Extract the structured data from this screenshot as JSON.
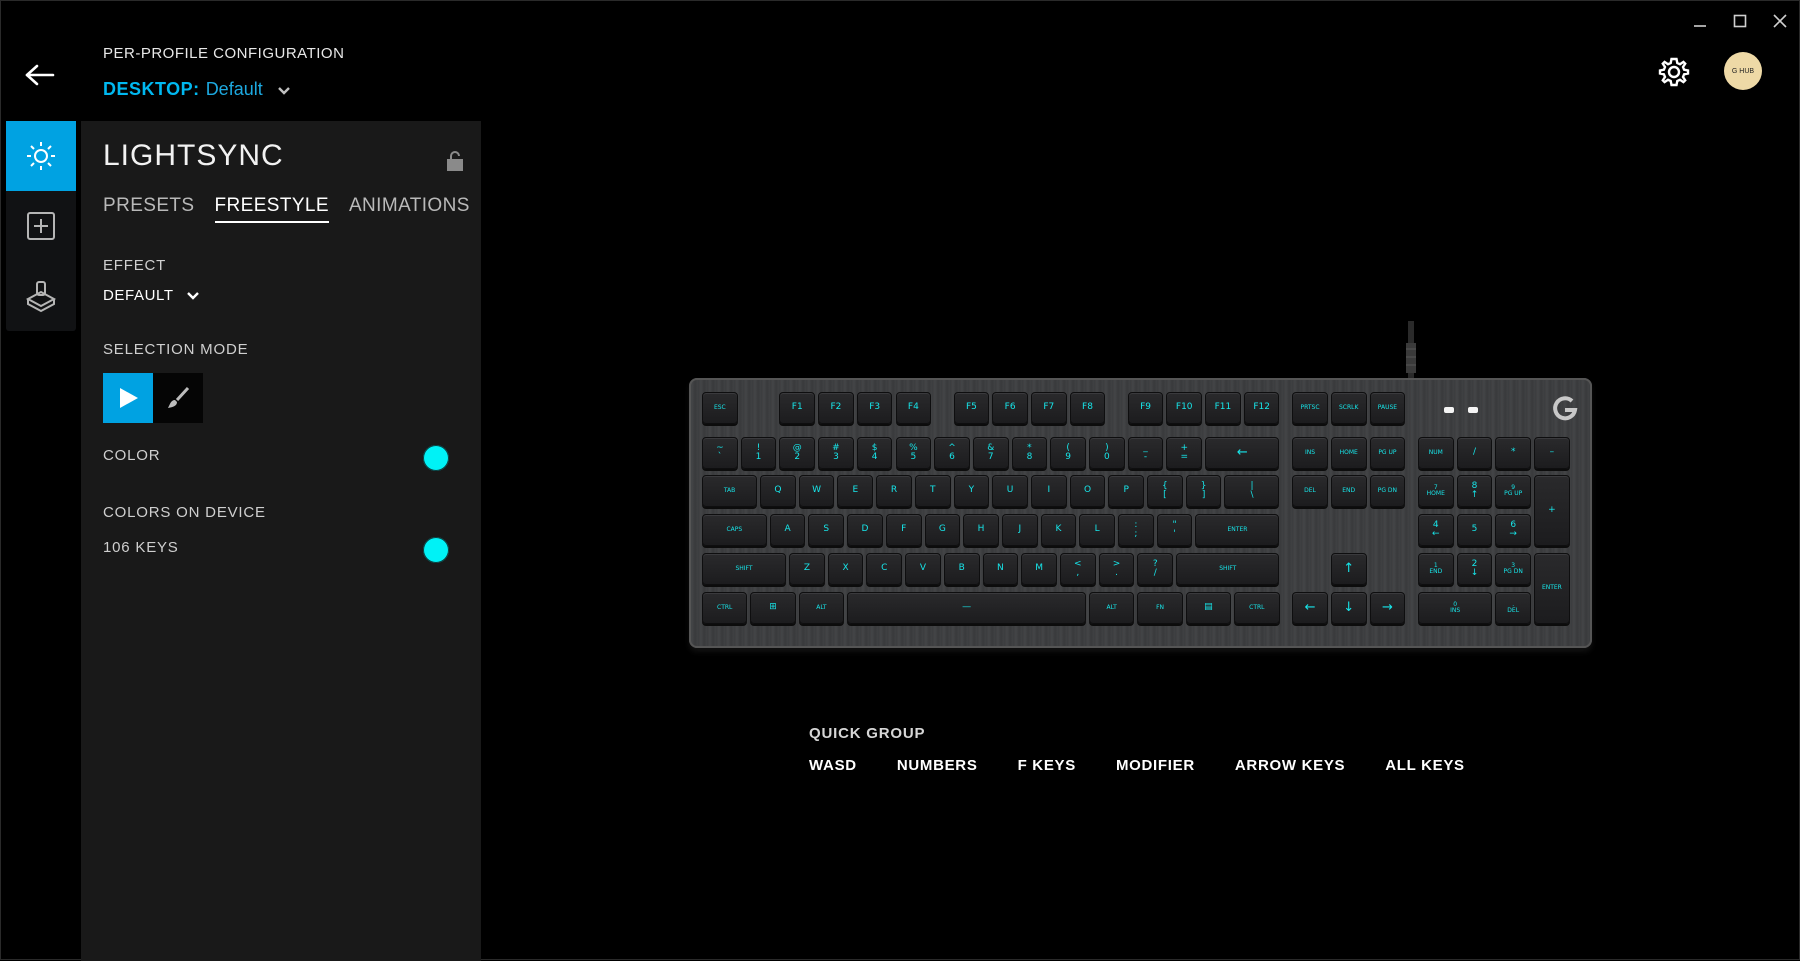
{
  "window": {
    "minimize_icon": "minimize-icon",
    "maximize_icon": "maximize-icon",
    "close_icon": "close-icon"
  },
  "header": {
    "config_title": "PER-PROFILE CONFIGURATION",
    "profile_key": "DESKTOP:",
    "profile_value": "Default",
    "avatar_text": "G HUB"
  },
  "rail": [
    "lightsync-icon",
    "assignments-icon",
    "game-mode-icon"
  ],
  "panel": {
    "title": "LIGHTSYNC",
    "tabs": [
      {
        "label": "PRESETS",
        "active": false
      },
      {
        "label": "FREESTYLE",
        "active": true
      },
      {
        "label": "ANIMATIONS",
        "active": false
      }
    ],
    "effect_label": "EFFECT",
    "effect_value": "DEFAULT",
    "selection_mode_label": "SELECTION MODE",
    "color_label": "COLOR",
    "color_value": "#00f2f6",
    "colors_on_device_label": "COLORS ON DEVICE",
    "keys_count_label": "106 KEYS",
    "keys_color": "#00f2f6"
  },
  "keyboard": {
    "accent": "#17e6ea",
    "keys": [
      {
        "id": "esc",
        "l": "ESC"
      },
      {
        "id": "f1",
        "l": "F1"
      },
      {
        "id": "f2",
        "l": "F2"
      },
      {
        "id": "f3",
        "l": "F3"
      },
      {
        "id": "f4",
        "l": "F4"
      },
      {
        "id": "f5",
        "l": "F5"
      },
      {
        "id": "f6",
        "l": "F6"
      },
      {
        "id": "f7",
        "l": "F7"
      },
      {
        "id": "f8",
        "l": "F8"
      },
      {
        "id": "f9",
        "l": "F9"
      },
      {
        "id": "f10",
        "l": "F10"
      },
      {
        "id": "f11",
        "l": "F11"
      },
      {
        "id": "f12",
        "l": "F12"
      },
      {
        "id": "prtsc",
        "l": "PRTSC"
      },
      {
        "id": "scrlk",
        "l": "SCRLK"
      },
      {
        "id": "pause",
        "l": "PAUSE"
      },
      {
        "id": "tilde",
        "l": "~\n`"
      },
      {
        "id": "n1",
        "l": "!\n1"
      },
      {
        "id": "n2",
        "l": "@\n2"
      },
      {
        "id": "n3",
        "l": "#\n3"
      },
      {
        "id": "n4",
        "l": "$\n4"
      },
      {
        "id": "n5",
        "l": "%\n5"
      },
      {
        "id": "n6",
        "l": "^\n6"
      },
      {
        "id": "n7",
        "l": "&\n7"
      },
      {
        "id": "n8",
        "l": "*\n8"
      },
      {
        "id": "n9",
        "l": "(\n9"
      },
      {
        "id": "n0",
        "l": ")\n0"
      },
      {
        "id": "minus",
        "l": "_\n-"
      },
      {
        "id": "equal",
        "l": "+\n="
      },
      {
        "id": "bksp",
        "l": "←"
      },
      {
        "id": "ins",
        "l": "INS"
      },
      {
        "id": "home",
        "l": "HOME"
      },
      {
        "id": "pgup",
        "l": "PG UP"
      },
      {
        "id": "num",
        "l": "NUM"
      },
      {
        "id": "ndiv",
        "l": "/"
      },
      {
        "id": "nmul",
        "l": "*"
      },
      {
        "id": "nsub",
        "l": "–"
      },
      {
        "id": "tab",
        "l": "TAB"
      },
      {
        "id": "q",
        "l": "Q"
      },
      {
        "id": "w",
        "l": "W"
      },
      {
        "id": "e",
        "l": "E"
      },
      {
        "id": "r",
        "l": "R"
      },
      {
        "id": "t",
        "l": "T"
      },
      {
        "id": "y",
        "l": "Y"
      },
      {
        "id": "u",
        "l": "U"
      },
      {
        "id": "i",
        "l": "I"
      },
      {
        "id": "o",
        "l": "O"
      },
      {
        "id": "p",
        "l": "P"
      },
      {
        "id": "lbr",
        "l": "{\n["
      },
      {
        "id": "rbr",
        "l": "}\n]"
      },
      {
        "id": "bslash",
        "l": "|\n\\"
      },
      {
        "id": "del",
        "l": "DEL"
      },
      {
        "id": "end",
        "l": "END"
      },
      {
        "id": "pgdn",
        "l": "PG DN"
      },
      {
        "id": "n7k",
        "l": "7\nHOME"
      },
      {
        "id": "n8k",
        "l": "8\n↑"
      },
      {
        "id": "n9k",
        "l": "9\nPG UP"
      },
      {
        "id": "nadd",
        "l": "+"
      },
      {
        "id": "caps",
        "l": "CAPS"
      },
      {
        "id": "a",
        "l": "A"
      },
      {
        "id": "s",
        "l": "S"
      },
      {
        "id": "d",
        "l": "D"
      },
      {
        "id": "f",
        "l": "F"
      },
      {
        "id": "g",
        "l": "G"
      },
      {
        "id": "h",
        "l": "H"
      },
      {
        "id": "j",
        "l": "J"
      },
      {
        "id": "k",
        "l": "K"
      },
      {
        "id": "lk",
        "l": "L"
      },
      {
        "id": "semi",
        "l": ":\n;"
      },
      {
        "id": "quote",
        "l": "\"\n'"
      },
      {
        "id": "enter",
        "l": "ENTER"
      },
      {
        "id": "n4k",
        "l": "4\n←"
      },
      {
        "id": "n5k",
        "l": "5"
      },
      {
        "id": "n6k",
        "l": "6\n→"
      },
      {
        "id": "lshift",
        "l": "SHIFT"
      },
      {
        "id": "z",
        "l": "Z"
      },
      {
        "id": "x",
        "l": "X"
      },
      {
        "id": "c",
        "l": "C"
      },
      {
        "id": "v",
        "l": "V"
      },
      {
        "id": "b",
        "l": "B"
      },
      {
        "id": "n",
        "l": "N"
      },
      {
        "id": "m",
        "l": "M"
      },
      {
        "id": "comma",
        "l": "<\n,"
      },
      {
        "id": "period",
        "l": ">\n."
      },
      {
        "id": "slash",
        "l": "?\n/"
      },
      {
        "id": "rshift",
        "l": "SHIFT"
      },
      {
        "id": "up",
        "l": "↑"
      },
      {
        "id": "n1k",
        "l": "1\nEND"
      },
      {
        "id": "n2k",
        "l": "2\n↓"
      },
      {
        "id": "n3k",
        "l": "3\nPG DN"
      },
      {
        "id": "nent",
        "l": "ENTER"
      },
      {
        "id": "lctrl",
        "l": "CTRL"
      },
      {
        "id": "win",
        "l": "⊞"
      },
      {
        "id": "lalt",
        "l": "ALT"
      },
      {
        "id": "space",
        "l": "—"
      },
      {
        "id": "ralt",
        "l": "ALT"
      },
      {
        "id": "fn",
        "l": "FN"
      },
      {
        "id": "menu",
        "l": "▤"
      },
      {
        "id": "rctrl",
        "l": "CTRL"
      },
      {
        "id": "left",
        "l": "←"
      },
      {
        "id": "down",
        "l": "↓"
      },
      {
        "id": "right",
        "l": "→"
      },
      {
        "id": "n0k",
        "l": "0\nINS"
      },
      {
        "id": "ndel",
        "l": ".\nDEL"
      }
    ]
  },
  "quick_group": {
    "title": "QUICK GROUP",
    "buttons": [
      "WASD",
      "NUMBERS",
      "F KEYS",
      "MODIFIER",
      "ARROW KEYS",
      "ALL KEYS"
    ]
  }
}
